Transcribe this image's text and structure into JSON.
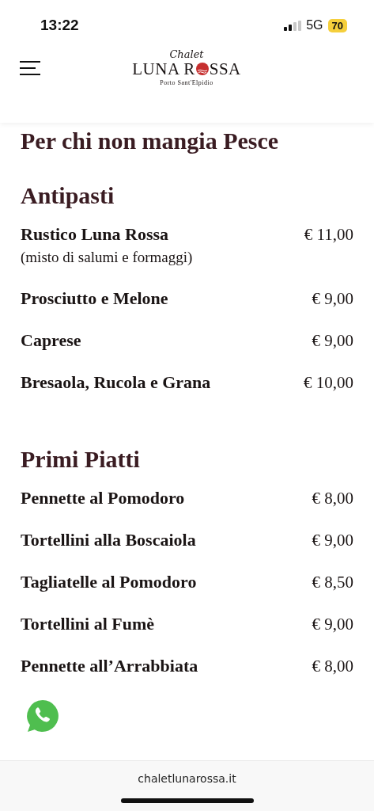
{
  "status_bar": {
    "time": "13:22",
    "network": "5G",
    "battery": "70"
  },
  "header": {
    "logo": {
      "top": "Chalet",
      "name_before": "LUNA R",
      "name_after": "SSA",
      "subtitle": "Porto Sant'Elpidio"
    }
  },
  "page_title": "Per chi non mangia Pesce",
  "sections": [
    {
      "title": "Antipasti",
      "items": [
        {
          "name": "Rustico Luna Rossa",
          "price": "€ 11,00",
          "note": "(misto di salumi e formaggi)"
        },
        {
          "name": "Prosciutto e Melone",
          "price": "€ 9,00"
        },
        {
          "name": "Caprese",
          "price": "€ 9,00"
        },
        {
          "name": "Bresaola, Rucola e Grana",
          "price": "€ 10,00"
        }
      ]
    },
    {
      "title": "Primi Piatti",
      "items": [
        {
          "name": "Pennette al Pomodoro",
          "price": "€ 8,00"
        },
        {
          "name": "Tortellini alla Boscaiola",
          "price": "€ 9,00"
        },
        {
          "name": "Tagliatelle al Pomodoro",
          "price": "€ 8,50"
        },
        {
          "name": "Tortellini al Fumè",
          "price": "€ 9,00"
        },
        {
          "name": "Pennette all’Arrabbiata",
          "price": "€ 8,00"
        }
      ]
    }
  ],
  "browser_bar": {
    "url": "chaletlunarossa.it"
  }
}
